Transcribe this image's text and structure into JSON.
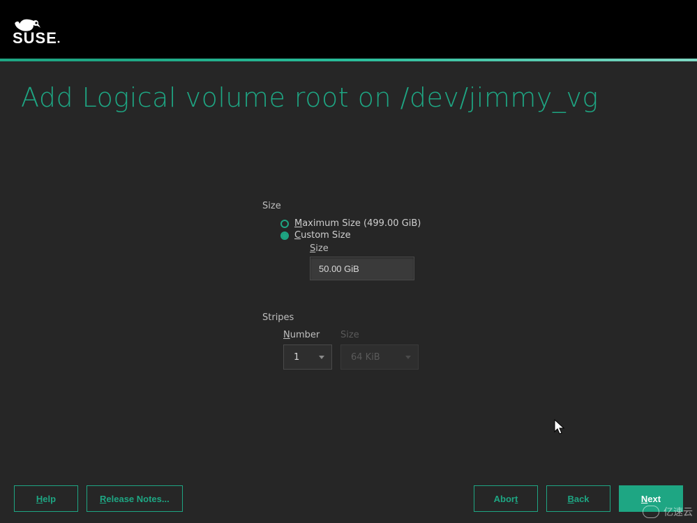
{
  "brand": "SUSE",
  "page_title": "Add Logical volume root on /dev/jimmy_vg",
  "size_group": {
    "label": "Size",
    "max_prefix": "M",
    "max_rest": "aximum Size (499.00 GiB)",
    "custom_prefix": "C",
    "custom_rest": "ustom Size",
    "size_sub_prefix": "S",
    "size_sub_rest": "ize",
    "size_value": "50.00 GiB"
  },
  "stripes_group": {
    "label": "Stripes",
    "number_prefix": "N",
    "number_rest": "umber",
    "number_value": "1",
    "stripe_size_label": "Size",
    "stripe_size_value": "64 KiB"
  },
  "footer": {
    "help_prefix": "H",
    "help_rest": "elp",
    "release_prefix": "R",
    "release_rest": "elease Notes...",
    "abort_prefix": "Abor",
    "abort_suffix": "t",
    "back_prefix": "B",
    "back_rest": "ack",
    "next_prefix": "N",
    "next_rest": "ext"
  },
  "watermark": "亿速云"
}
